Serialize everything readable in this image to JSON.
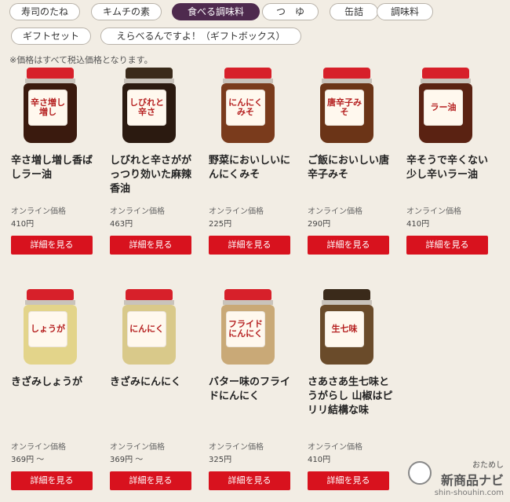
{
  "tabs": [
    "寿司のたね",
    "キムチの素",
    "食べる調味料",
    "つ　ゆ",
    "缶詰",
    "調味料",
    "ギフトセット",
    "えらべるんですよ！（ギフトボックス）"
  ],
  "active_tab": "食べる調味料",
  "note": "※価格はすべて税込価格となります。",
  "price_label": "オンライン価格",
  "button_label": "詳細を見る",
  "products": [
    {
      "name": "辛さ増し増し香ばしラー油",
      "price": "410円",
      "jar_text": "辛さ増し増し",
      "body_color": "#3a1a0e",
      "lid": "red"
    },
    {
      "name": "しびれと辛さががっつり効いた麻辣香油",
      "price": "463円",
      "jar_text": "しびれと辛さ",
      "body_color": "#2b1a10",
      "lid": "dark"
    },
    {
      "name": "野菜においしいにんにくみそ",
      "price": "225円",
      "jar_text": "にんにくみそ",
      "body_color": "#7a3b1c",
      "lid": "red"
    },
    {
      "name": "ご飯においしい唐辛子みそ",
      "price": "290円",
      "jar_text": "唐辛子みそ",
      "body_color": "#6b3417",
      "lid": "red"
    },
    {
      "name": "辛そうで辛くない少し辛いラー油",
      "price": "410円",
      "jar_text": "ラー油",
      "body_color": "#5a2212",
      "lid": "red"
    },
    {
      "name": "きざみしょうが",
      "price": "369円 ～",
      "jar_text": "しょうが",
      "body_color": "#e3d48a",
      "lid": "red"
    },
    {
      "name": "きざみにんにく",
      "price": "369円 ～",
      "jar_text": "にんにく",
      "body_color": "#d9c98a",
      "lid": "red"
    },
    {
      "name": "バター味のフライドにんにく",
      "price": "325円",
      "jar_text": "フライドにんにく",
      "body_color": "#c9a977",
      "lid": "red"
    },
    {
      "name": "さあさあ生七味とうがらし 山椒はピリリ結構な味",
      "price": "410円",
      "jar_text": "生七味",
      "body_color": "#6a4b2a",
      "lid": "dark"
    }
  ],
  "watermark": {
    "top": "おためし",
    "main": "新商品ナビ",
    "url": "shin-shouhin.com"
  }
}
